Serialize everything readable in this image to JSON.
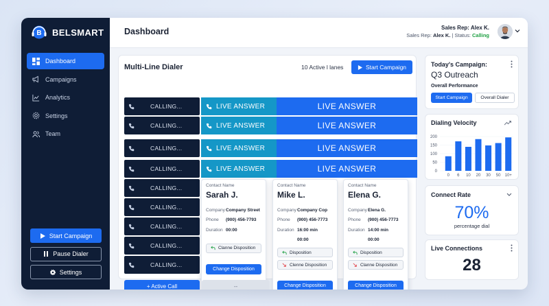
{
  "app": {
    "brand": "BELSMART"
  },
  "sidebar": {
    "items": [
      {
        "label": "Dashboard",
        "icon": "dashboard-icon",
        "active": true
      },
      {
        "label": "Campaigns",
        "icon": "megaphone-icon",
        "active": false
      },
      {
        "label": "Analytics",
        "icon": "chart-icon",
        "active": false
      },
      {
        "label": "Settings",
        "icon": "gear-icon",
        "active": false
      },
      {
        "label": "Team",
        "icon": "users-icon",
        "active": false
      }
    ],
    "buttons": {
      "start_campaign": "Start Campaign",
      "pause_dialer": "Pause Dialer",
      "settings": "Settings"
    }
  },
  "header": {
    "title": "Dashboard",
    "user_name": "Sales Rep: Alex K.",
    "status_prefix": "Sales Rep: ",
    "status_name": "Alex K.",
    "status_sep": " | Status: ",
    "status_value": "Calling"
  },
  "dialer": {
    "title": "Multi-Line Dialer",
    "lanes_text": "10 Active l lanes",
    "start_campaign": "Start Campaign",
    "calling_label": "CALLING...",
    "live_label": "LIVE ANSWER",
    "active_call_label": "+ Active Call",
    "placeholder_label": "--",
    "cards": [
      {
        "contact_label": "Contact Name",
        "name": "Sarah J.",
        "company_label": "Company",
        "company": "Company Street",
        "phone_label": "Phone",
        "phone": "(900) 456-7793",
        "duration_label": "Duration",
        "duration": "00:00",
        "dispositions": [
          {
            "label": "Clanne Disposition",
            "icon": "reply-icon"
          }
        ],
        "change_label": "Change Disposition"
      },
      {
        "contact_label": "Contact Name",
        "name": "Mike L.",
        "company_label": "Company",
        "company": "Company Cop",
        "phone_label": "Phone",
        "phone": "(900) 456-7773",
        "duration_label": "Duration",
        "duration": "16:00 min",
        "duration2": "00:00",
        "dispositions": [
          {
            "label": "Disposition",
            "icon": "reply-icon"
          },
          {
            "label": "Clenne Disposition",
            "icon": "missed-call-icon"
          }
        ],
        "change_label": "Change Disposition"
      },
      {
        "contact_label": "Contact Name",
        "name": "Elena G.",
        "company_label": "Company",
        "company": "Elena G.",
        "phone_label": "Phone",
        "phone": "(900) 456-7773",
        "duration_label": "Duration",
        "duration": "14:00 min",
        "duration2": "00:00",
        "dispositions": [
          {
            "label": "Disposition",
            "icon": "reply-icon"
          },
          {
            "label": "Clanne Disposition",
            "icon": "missed-call-icon"
          }
        ],
        "change_label": "Change Disposition"
      }
    ]
  },
  "campaign_panel": {
    "title": "Today's Campaign:",
    "name": "Q3 Outreach",
    "performance_label": "Overall Performance",
    "btn_start": "Start Campaign",
    "btn_overall": "Overall Dialer"
  },
  "velocity_panel": {
    "title": "Dialing Velocity"
  },
  "chart_data": {
    "type": "bar",
    "categories": [
      "0",
      "6",
      "10",
      "20",
      "30",
      "50",
      "10+"
    ],
    "values": [
      85,
      172,
      140,
      185,
      148,
      162,
      195
    ],
    "ylim": [
      0,
      200
    ],
    "yticks": [
      "200",
      "150",
      "100",
      "50",
      "0"
    ],
    "color": "#1d6bf0"
  },
  "connect_panel": {
    "title": "Connect Rate",
    "value": "70%",
    "sub": "percentage dial"
  },
  "live_panel": {
    "title": "Live Connections",
    "value": "28"
  },
  "colors": {
    "accent": "#1d6bf0",
    "sidebar": "#0f1d36",
    "live_teal": "#1597c7",
    "status_calling": "#1fa043"
  }
}
